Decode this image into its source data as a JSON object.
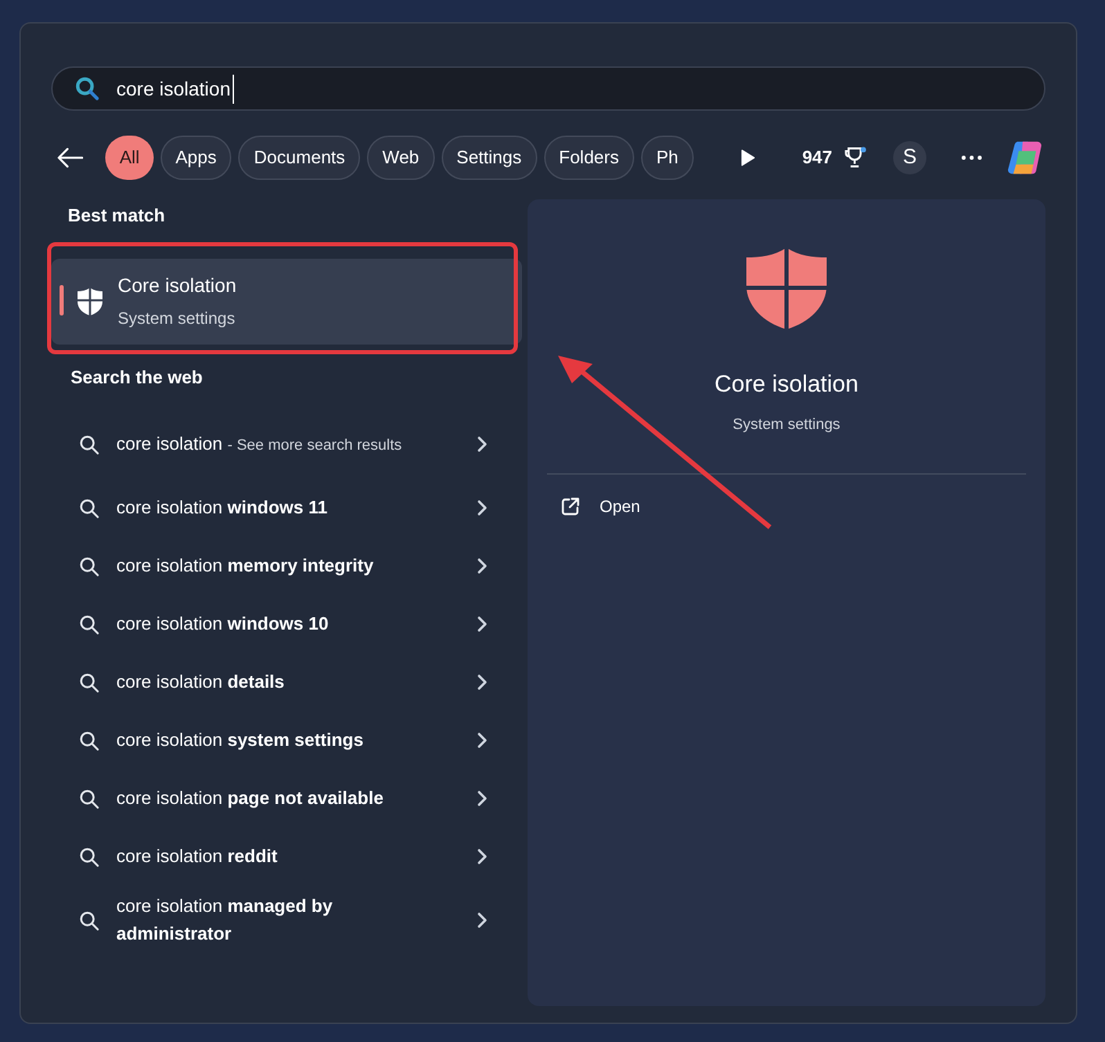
{
  "search": {
    "value": "core isolation"
  },
  "filters": [
    {
      "label": "All",
      "selected": true
    },
    {
      "label": "Apps",
      "selected": false
    },
    {
      "label": "Documents",
      "selected": false
    },
    {
      "label": "Web",
      "selected": false
    },
    {
      "label": "Settings",
      "selected": false
    },
    {
      "label": "Folders",
      "selected": false
    },
    {
      "label": "Ph",
      "selected": false
    }
  ],
  "points": "947",
  "avatar": "S",
  "best_match": {
    "heading": "Best match",
    "title": "Core isolation",
    "subtitle": "System settings",
    "selected": true
  },
  "web": {
    "heading": "Search the web",
    "items": [
      {
        "kind": "more",
        "text": "core isolation",
        "note": "- See more search results"
      },
      {
        "kind": "suggestion",
        "text": "core isolation **windows 11**"
      },
      {
        "kind": "suggestion",
        "text": "core isolation **memory integrity**"
      },
      {
        "kind": "suggestion",
        "text": "core isolation **windows 10**"
      },
      {
        "kind": "suggestion",
        "text": "core isolation **details**"
      },
      {
        "kind": "suggestion",
        "text": "core isolation **system settings**"
      },
      {
        "kind": "suggestion",
        "text": "core isolation **page not available**"
      },
      {
        "kind": "suggestion",
        "text": "core isolation **reddit**"
      },
      {
        "kind": "suggestion",
        "text": "core isolation **managed by administrator**"
      }
    ]
  },
  "detail": {
    "title": "Core isolation",
    "subtitle": "System settings",
    "actions": [
      {
        "label": "Open"
      }
    ]
  }
}
